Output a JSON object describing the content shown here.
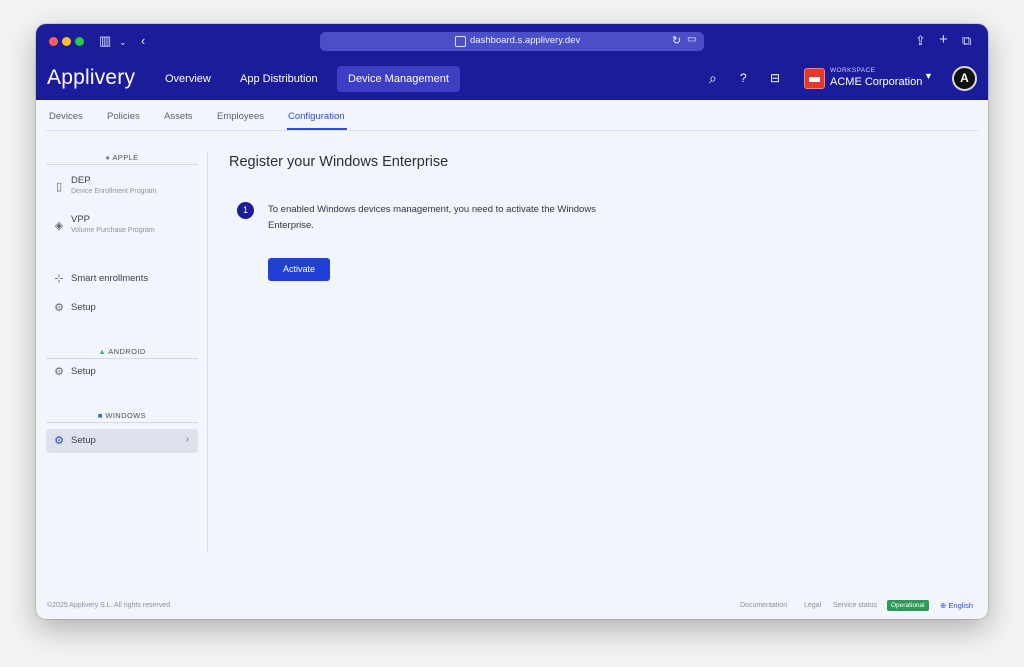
{
  "browser": {
    "url": "dashboard.s.applivery.dev"
  },
  "header": {
    "logo": "Applivery",
    "nav": [
      {
        "label": "Overview"
      },
      {
        "label": "App Distribution"
      },
      {
        "label": "Device Management",
        "active": true
      }
    ],
    "workspace_label": "WORKSPACE",
    "workspace_name": "ACME Corporation",
    "avatar_letter": "A"
  },
  "subnav": {
    "tabs": [
      {
        "label": "Devices"
      },
      {
        "label": "Policies"
      },
      {
        "label": "Assets"
      },
      {
        "label": "Employees"
      },
      {
        "label": "Configuration",
        "active": true
      }
    ]
  },
  "sidebar": {
    "sections": [
      {
        "title": "APPLE",
        "items": [
          {
            "label": "DEP",
            "sub": "Device Enrollment Program",
            "icon": "phone-icon"
          },
          {
            "label": "VPP",
            "sub": "Volume Purchase Program",
            "icon": "layers-icon"
          },
          {
            "label": "Smart enrollments",
            "icon": "nodes-icon"
          },
          {
            "label": "Setup",
            "icon": "gear-icon"
          }
        ]
      },
      {
        "title": "ANDROID",
        "items": [
          {
            "label": "Setup",
            "icon": "gear-icon"
          }
        ]
      },
      {
        "title": "WINDOWS",
        "items": [
          {
            "label": "Setup",
            "icon": "gear-icon",
            "active": true
          }
        ]
      }
    ]
  },
  "main": {
    "title": "Register your Windows Enterprise",
    "step_number": "1",
    "step_text": "To enabled Windows devices management, you need to activate the Windows Enterprise.",
    "activate_label": "Activate"
  },
  "footer": {
    "copyright": "©2025 Applivery S.L. All rights reserved.",
    "documentation": "Documentation",
    "legal": "Legal",
    "service_status": "Service status",
    "status_badge": "Operational",
    "language": "English"
  },
  "colors": {
    "brand_header": "#1a1c9a",
    "accent": "#1f3fd6",
    "status_ok": "#2e9a57"
  }
}
